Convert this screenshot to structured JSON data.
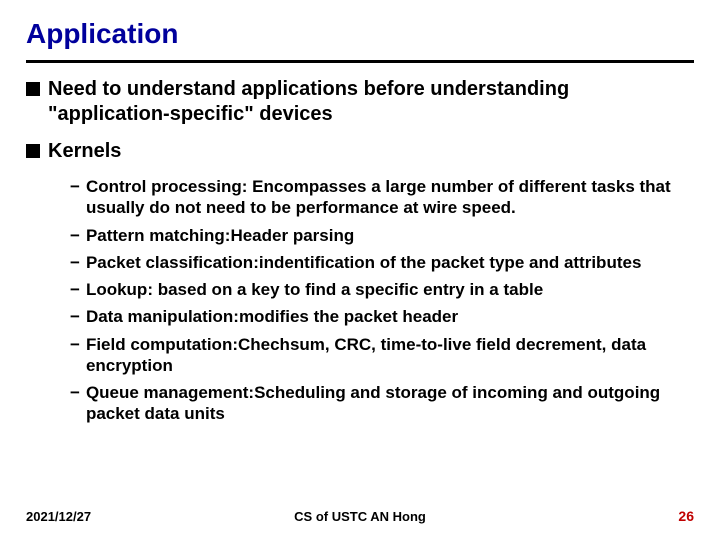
{
  "title": "Application",
  "bullets": [
    {
      "text": "Need to understand applications before understanding \"application-specific\" devices",
      "subs": []
    },
    {
      "text": "Kernels",
      "subs": [
        "Control processing: Encompasses a large number of different tasks that usually do not need to be performance at wire speed.",
        "Pattern matching:Header parsing",
        "Packet classification:indentification of the packet type and attributes",
        "Lookup: based on a key to find a specific entry in a table",
        "Data manipulation:modifies the packet header",
        "Field computation:Chechsum, CRC, time-to-live field decrement, data encryption",
        "Queue management:Scheduling and storage of incoming and outgoing packet data units"
      ]
    }
  ],
  "footer": {
    "date": "2021/12/27",
    "center": "CS of USTC AN Hong",
    "page": "26"
  }
}
